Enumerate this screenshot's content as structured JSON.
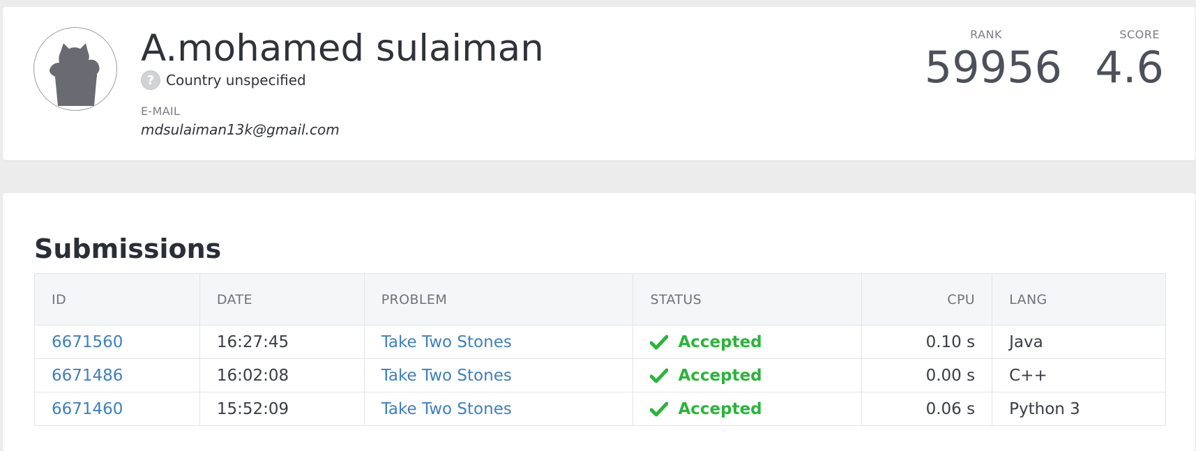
{
  "profile": {
    "name": "A.mohamed sulaiman",
    "country_flag_glyph": "?",
    "country": "Country unspecified",
    "email_label": "E-MAIL",
    "email": "mdsulaiman13k@gmail.com",
    "avatar_icon": "user-silhouette-icon"
  },
  "stats": {
    "rank_label": "RANK",
    "rank_value": "59956",
    "score_label": "SCORE",
    "score_value": "4.6"
  },
  "submissions": {
    "title": "Submissions",
    "columns": {
      "id": "ID",
      "date": "DATE",
      "problem": "PROBLEM",
      "status": "STATUS",
      "cpu": "CPU",
      "lang": "LANG"
    },
    "rows": [
      {
        "id": "6671560",
        "date": "16:27:45",
        "problem": "Take Two Stones",
        "status": "Accepted",
        "cpu": "0.10 s",
        "lang": "Java"
      },
      {
        "id": "6671486",
        "date": "16:02:08",
        "problem": "Take Two Stones",
        "status": "Accepted",
        "cpu": "0.00 s",
        "lang": "C++"
      },
      {
        "id": "6671460",
        "date": "15:52:09",
        "problem": "Take Two Stones",
        "status": "Accepted",
        "cpu": "0.06 s",
        "lang": "Python 3"
      }
    ]
  },
  "colors": {
    "accepted": "#2ab53a",
    "link": "#3d7fc2",
    "background": "#ececec"
  }
}
